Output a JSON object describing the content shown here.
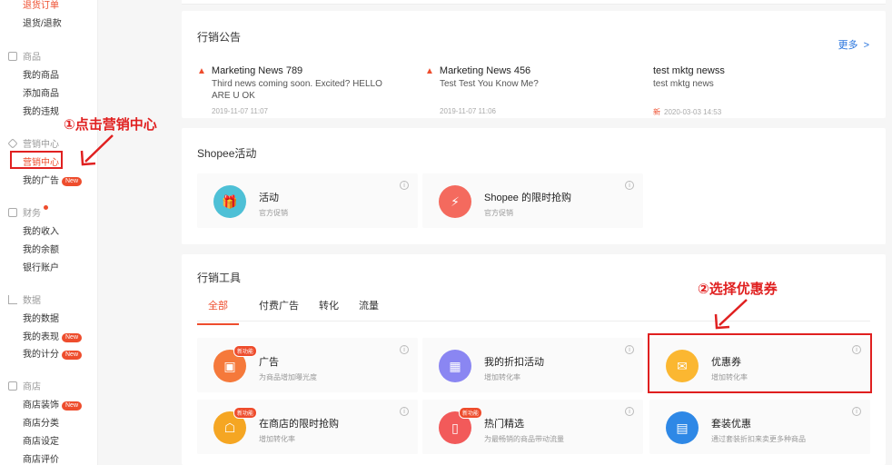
{
  "sidebar": {
    "order_items": [
      {
        "label": "退货订单"
      },
      {
        "label": "退货/退款"
      }
    ],
    "products_group": "商品",
    "products_items": [
      {
        "label": "我的商品"
      },
      {
        "label": "添加商品"
      },
      {
        "label": "我的违规"
      }
    ],
    "marketing_group": "营销中心",
    "marketing_items": [
      {
        "label": "营销中心"
      },
      {
        "label": "我的广告",
        "badge": "New"
      }
    ],
    "finance_group": "财务",
    "finance_items": [
      {
        "label": "我的收入"
      },
      {
        "label": "我的余额"
      },
      {
        "label": "银行账户"
      }
    ],
    "data_group": "数据",
    "data_items": [
      {
        "label": "我的数据"
      },
      {
        "label": "我的表现",
        "badge": "New"
      },
      {
        "label": "我的计分",
        "badge": "New"
      }
    ],
    "shop_group": "商店",
    "shop_items": [
      {
        "label": "商店装饰",
        "badge": "New"
      },
      {
        "label": "商店分类"
      },
      {
        "label": "商店设定"
      },
      {
        "label": "商店评价"
      }
    ]
  },
  "annotations": {
    "step1": "①点击营销中心",
    "step2": "②选择优惠券"
  },
  "announcements": {
    "title": "行销公告",
    "more": "更多",
    "news": [
      {
        "title": "Marketing News 789",
        "desc": "Third news coming soon. Excited? HELLO ARE U OK",
        "date": "2019-11-07 11:07"
      },
      {
        "title": "Marketing News 456",
        "desc": "Test Test You Know Me?",
        "date": "2019-11-07 11:06"
      },
      {
        "title": "test mktg newss",
        "desc": "test mktg news",
        "new_tag": "新",
        "date": "2020-03-03 14:53"
      }
    ]
  },
  "shopee_activity": {
    "title": "Shopee活动",
    "cards": [
      {
        "title": "活动",
        "desc": "官方促销",
        "icon": "gift-icon",
        "color": "#4ec0d6"
      },
      {
        "title": "Shopee 的限时抢购",
        "desc": "官方促销",
        "icon": "flash-icon",
        "color": "#f46a5e"
      }
    ]
  },
  "marketing_tools": {
    "title": "行销工具",
    "tabs": [
      {
        "label": "全部"
      },
      {
        "label": "付费广告"
      },
      {
        "label": "转化"
      },
      {
        "label": "流量"
      }
    ],
    "cards": [
      {
        "title": "广告",
        "desc": "为商品增加曝光度",
        "badge": "新功能",
        "icon": "ads-icon",
        "color": "#f5793b"
      },
      {
        "title": "我的折扣活动",
        "desc": "增加转化率",
        "icon": "discount-icon",
        "color": "#8a86f2"
      },
      {
        "title": "优惠券",
        "desc": "增加转化率",
        "icon": "coupon-icon",
        "color": "#fbb731"
      },
      {
        "title": "在商店的限时抢购",
        "desc": "增加转化率",
        "badge": "新功能",
        "icon": "shop-flash-icon",
        "color": "#f5a623"
      },
      {
        "title": "热门精选",
        "desc": "为最畅销的商品带动流量",
        "badge": "新功能",
        "icon": "top-picks-icon",
        "color": "#f25a5a"
      },
      {
        "title": "套装优惠",
        "desc": "通过套装折扣来卖更多种商品",
        "icon": "bundle-icon",
        "color": "#2e88e6"
      }
    ]
  }
}
